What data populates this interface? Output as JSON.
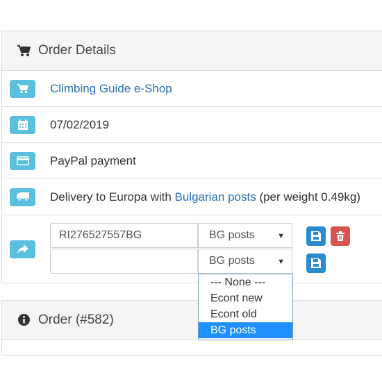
{
  "order_details": {
    "title": "Order Details",
    "store_name": "Climbing Guide e-Shop",
    "date": "07/02/2019",
    "payment_method": "PayPal payment",
    "shipping": {
      "prefix": "Delivery to Europa with ",
      "carrier_link": "Bulgarian posts",
      "suffix": " (per weight 0.49kg)"
    },
    "tracking": {
      "row1": {
        "number": "RI276527557BG",
        "carrier": "BG posts"
      },
      "row2": {
        "number": "",
        "carrier": "BG posts"
      }
    },
    "carrier_options": [
      "--- None ---",
      "Econt new",
      "Econt old",
      "BG posts"
    ],
    "carrier_options_selected": "BG posts"
  },
  "order": {
    "title": "Order (#582)"
  },
  "colors": {
    "info": "#5bc0de",
    "primary": "#2a8bd0",
    "danger": "#d9534f",
    "link": "#2a6fb5",
    "highlight": "#1e90ff"
  },
  "icons": {
    "heading": "shopping-cart-icon",
    "store": "shopping-cart-icon",
    "date": "calendar-icon",
    "payment": "credit-card-icon",
    "shipping": "truck-icon",
    "tracking": "share-arrow-icon",
    "save": "floppy-disk-icon",
    "delete": "trash-icon",
    "order": "info-circle-icon"
  }
}
